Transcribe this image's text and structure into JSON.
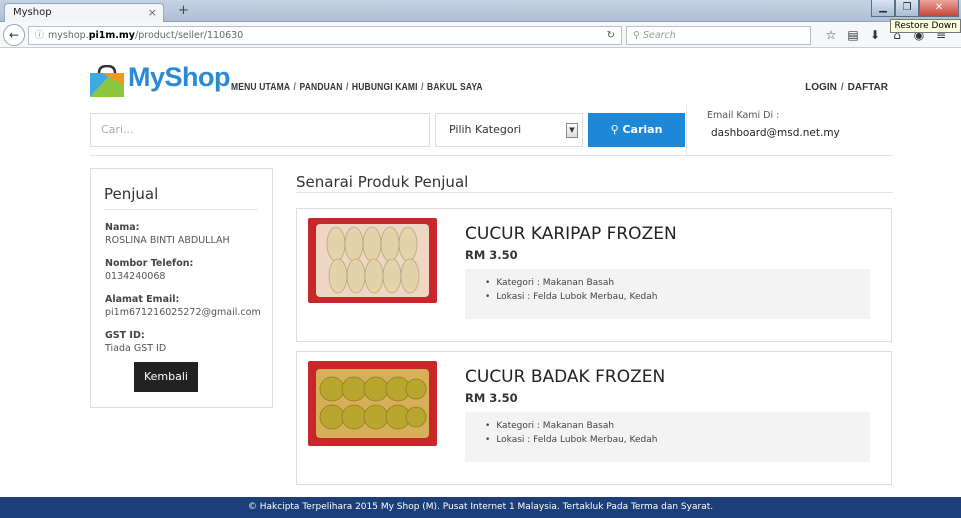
{
  "browser": {
    "tab_title": "Myshop",
    "tab_close": "×",
    "new_tab": "+",
    "tooltip": "Restore Down",
    "url_prefix": "myshop.",
    "url_domain": "pi1m.my",
    "url_path": "/product/seller/110630",
    "search_placeholder": "Search"
  },
  "header": {
    "brand": "MyShop",
    "menu": [
      "MENU UTAMA",
      "PANDUAN",
      "HUBUNGI KAMI",
      "BAKUL SAYA"
    ],
    "login": "LOGIN",
    "register": "DAFTAR"
  },
  "search": {
    "placeholder": "Cari...",
    "category": "Pilih Kategori",
    "button": "Carian",
    "email_label": "Email Kami Di :",
    "email_value": "dashboard@msd.net.my"
  },
  "seller": {
    "title": "Penjual",
    "fields": [
      {
        "label": "Nama:",
        "value": "ROSLINA BINTI ABDULLAH"
      },
      {
        "label": "Nombor Telefon:",
        "value": "0134240068"
      },
      {
        "label": "Alamat Email:",
        "value": "pi1m671216025272@gmail.com"
      },
      {
        "label": "GST ID:",
        "value": "Tiada GST ID"
      }
    ],
    "back_button": "Kembali"
  },
  "products": {
    "title": "Senarai Produk Penjual",
    "items": [
      {
        "name": "CUCUR KARIPAP FROZEN",
        "price": "RM 3.50",
        "category": "Kategori : Makanan Basah",
        "location": "Lokasi : Felda Lubok Merbau, Kedah",
        "color": "#e9dfc2"
      },
      {
        "name": "CUCUR BADAK FROZEN",
        "price": "RM 3.50",
        "category": "Kategori : Makanan Basah",
        "location": "Lokasi : Felda Lubok Merbau, Kedah",
        "color": "#c9b53a"
      }
    ]
  },
  "footer": {
    "text": "© Hakcipta Terpelihara 2015 My Shop (M). Pusat Internet 1 Malaysia. Tertakluk Pada Terma dan Syarat."
  },
  "colors": {
    "brand_blue": "#2a8ad4",
    "button_blue": "#1e88d8",
    "footer_navy": "#1c3f79",
    "package_red": "#c8262a"
  }
}
